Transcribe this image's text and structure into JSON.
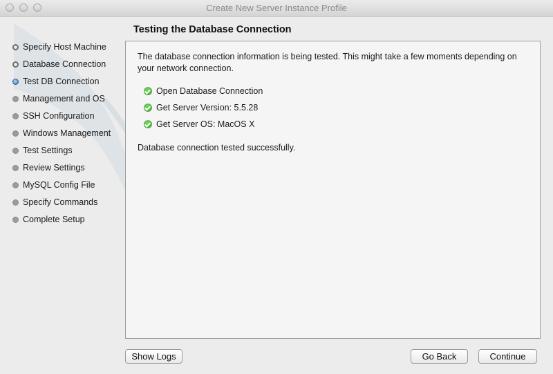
{
  "window": {
    "title": "Create New Server Instance Profile"
  },
  "sidebar": {
    "items": [
      {
        "label": "Specify Host Machine",
        "status": "done"
      },
      {
        "label": "Database Connection",
        "status": "done"
      },
      {
        "label": "Test DB Connection",
        "status": "current"
      },
      {
        "label": "Management and OS",
        "status": "pending"
      },
      {
        "label": "SSH Configuration",
        "status": "pending"
      },
      {
        "label": "Windows Management",
        "status": "pending"
      },
      {
        "label": "Test Settings",
        "status": "pending"
      },
      {
        "label": "Review Settings",
        "status": "pending"
      },
      {
        "label": "MySQL Config File",
        "status": "pending"
      },
      {
        "label": "Specify Commands",
        "status": "pending"
      },
      {
        "label": "Complete Setup",
        "status": "pending"
      }
    ]
  },
  "main": {
    "title": "Testing the Database Connection",
    "intro": "The database connection information is being tested. This might take a few moments depending on your network connection.",
    "tasks": [
      {
        "label": "Open Database Connection",
        "icon": "check-circle-icon"
      },
      {
        "label": "Get Server Version: 5.5.28",
        "icon": "check-circle-icon"
      },
      {
        "label": "Get Server OS: MacOS X",
        "icon": "check-circle-icon"
      }
    ],
    "result": "Database connection tested successfully."
  },
  "buttons": {
    "show_logs": "Show Logs",
    "go_back": "Go Back",
    "continue": "Continue"
  },
  "colors": {
    "success": "#2f9b25",
    "current_step": "#3b6fb6"
  }
}
